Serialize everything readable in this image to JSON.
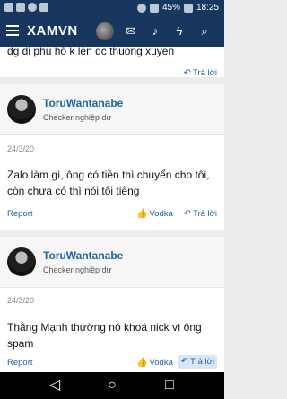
{
  "status_bar": {
    "battery": "45%",
    "time": "18:25"
  },
  "header": {
    "logo": "XAMVN"
  },
  "partial_post": {
    "text": "dg di phụ hồ k lên dc thuong xuyen",
    "reply_label": "Trả lời"
  },
  "posts": [
    {
      "username": "ToruWantanabe",
      "user_title": "Checker nghiệp dư",
      "date": "24/3/20",
      "message": "Zalo làm gì, ông có tiền thì chuyển cho tôi, còn chưa có thì nói tôi tiếng",
      "report_label": "Report",
      "like_label": "Vodka",
      "reply_label": "Trả lời"
    },
    {
      "username": "ToruWantanabe",
      "user_title": "Checker nghiệp dư",
      "date": "24/3/20",
      "message": "Thằng Mạnh thường nó khoá nick vì ông spam",
      "report_label": "Report",
      "like_label": "Vodka",
      "reply_label": "Trả lời"
    }
  ],
  "icons": {
    "nav_back": "back-triangle",
    "nav_home": "home-circle",
    "nav_recent": "recent-square"
  }
}
